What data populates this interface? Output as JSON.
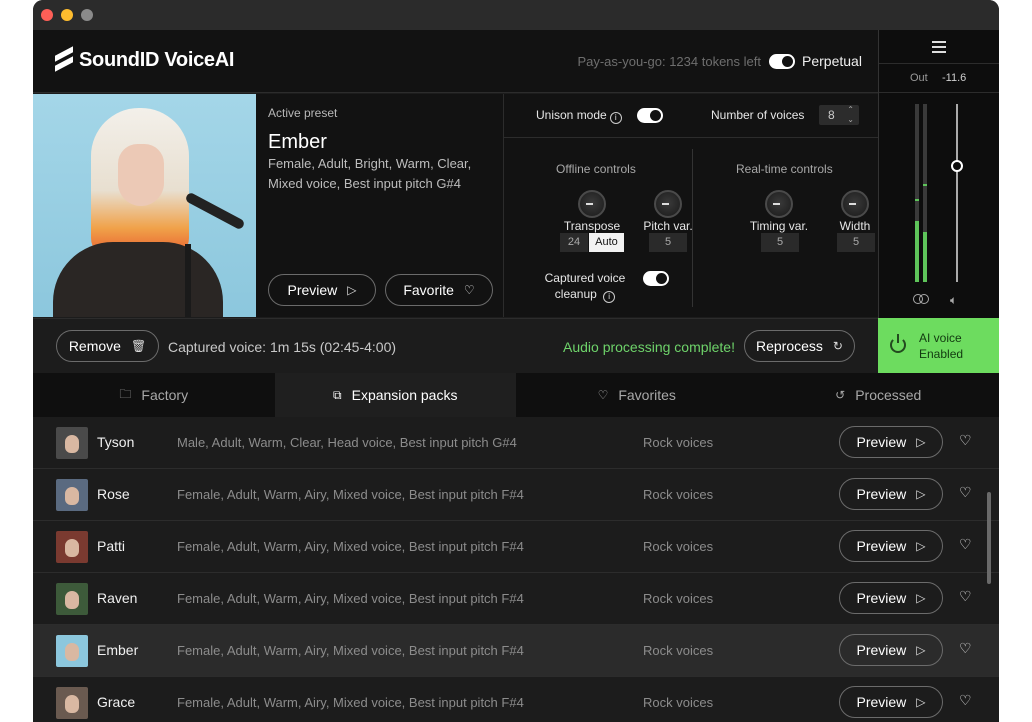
{
  "app": {
    "name": "SoundID VoiceAI",
    "tokens": "Pay-as-you-go: 1234 tokens left",
    "perpetual_label": "Perpetual",
    "perpetual_on": true
  },
  "output": {
    "out_label": "Out",
    "out_value": "-11.6",
    "meter_left": 0.34,
    "meter_right": 0.28,
    "fader_level": 0.65
  },
  "preset": {
    "label": "Active preset",
    "name": "Ember",
    "description": "Female, Adult, Bright, Warm, Clear, Mixed voice, Best input pitch  G#4",
    "preview_label": "Preview",
    "favorite_label": "Favorite"
  },
  "controls": {
    "unison_label": "Unison mode",
    "unison_on": true,
    "voices_label": "Number of voices",
    "voices_value": "8",
    "offline_title": "Offline controls",
    "realtime_title": "Real-time controls",
    "transpose_label": "Transpose",
    "transpose_value": "24",
    "transpose_mode": "Auto",
    "pitch_label": "Pitch var.",
    "pitch_value": "5",
    "timing_label": "Timing var.",
    "timing_value": "5",
    "width_label": "Width",
    "width_value": "5",
    "cleanup_label": "Captured voice cleanup",
    "cleanup_on": true
  },
  "actionbar": {
    "remove_label": "Remove",
    "captured": "Captured voice: 1m 15s (02:45-4:00)",
    "status": "Audio processing complete!",
    "reprocess_label": "Reprocess",
    "ai_voice_line1": "AI voice",
    "ai_voice_line2": "Enabled"
  },
  "tabs": [
    {
      "label": "Factory",
      "icon": "folder-icon",
      "active": false
    },
    {
      "label": "Expansion packs",
      "icon": "box-icon",
      "active": true
    },
    {
      "label": "Favorites",
      "icon": "heart-icon",
      "active": false
    },
    {
      "label": "Processed",
      "icon": "history-icon",
      "active": false
    }
  ],
  "row_preview_label": "Preview",
  "voices": [
    {
      "name": "Tyson",
      "desc": "Male, Adult, Warm, Clear, Head voice, Best input pitch  G#4",
      "category": "Rock voices",
      "active": false,
      "avatar": "#4a4a4a"
    },
    {
      "name": "Rose",
      "desc": "Female, Adult, Warm, Airy, Mixed voice, Best input pitch  F#4",
      "category": "Rock voices",
      "active": false,
      "avatar": "#5a6a80"
    },
    {
      "name": "Patti",
      "desc": "Female, Adult, Warm, Airy, Mixed voice, Best input pitch  F#4",
      "category": "Rock voices",
      "active": false,
      "avatar": "#7a3a30"
    },
    {
      "name": "Raven",
      "desc": "Female, Adult, Warm, Airy, Mixed voice, Best input pitch  F#4",
      "category": "Rock voices",
      "active": false,
      "avatar": "#3d5a3a"
    },
    {
      "name": "Ember",
      "desc": "Female, Adult, Warm, Airy, Mixed voice, Best input pitch  F#4",
      "category": "Rock voices",
      "active": true,
      "avatar": "#8cc7dd"
    },
    {
      "name": "Grace",
      "desc": "Female, Adult, Warm, Airy, Mixed voice, Best input pitch  F#4",
      "category": "Rock voices",
      "active": false,
      "avatar": "#6a5a50"
    }
  ],
  "colors": {
    "accent_green": "#6ddc5f",
    "status_green": "#6ed36a",
    "background": "#1c1c1c"
  }
}
